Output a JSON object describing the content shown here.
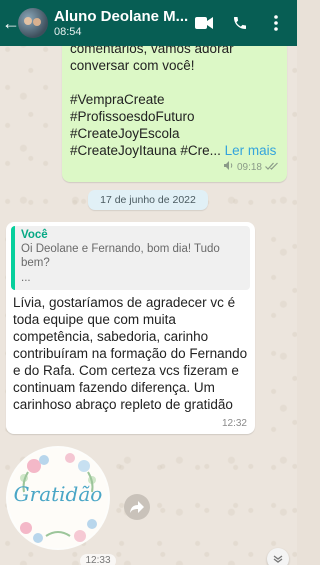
{
  "header": {
    "back_symbol": "←",
    "title": "Aluno Deolane M...",
    "subtitle": "08:54",
    "icons": [
      "video-call-icon",
      "phone-icon",
      "more-icon"
    ]
  },
  "outgoing_message": {
    "lines": [
      "comentários, vamos adorar",
      "conversar com você!",
      "",
      "#VempraCreate",
      "#ProfissoesdoFuturo",
      "#CreateJoyEscola"
    ],
    "last_line": "#CreateJoyItauna #Cre...",
    "read_more": "Ler mais",
    "time": "09:18"
  },
  "date_divider": "17 de junho de 2022",
  "incoming_message": {
    "quote_author": "Você",
    "quote_text": "Oi Deolane e Fernando, bom dia! Tudo bem?",
    "quote_ellipsis": "...",
    "body": "Lívia, gostaríamos de agradecer vc é toda equipe que com muita competência, sabedoria, carinho contribuíram na formação do Fernando e do Rafa. Com certeza vcs fizeram e continuam fazendo diferença. Um carinhoso abraço repleto de gratidão",
    "time": "12:32"
  },
  "sticker": {
    "word": "Gratidão",
    "time": "12:33"
  },
  "colors": {
    "header": "#075e54",
    "outgoing_bubble": "#dcf8c6",
    "incoming_bubble": "#ffffff",
    "quote_accent": "#06cf9c",
    "link": "#34a4dc"
  }
}
